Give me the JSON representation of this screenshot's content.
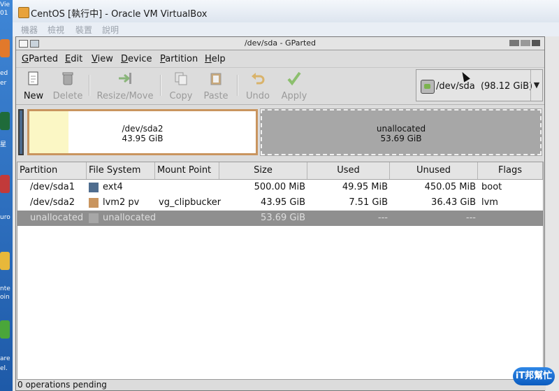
{
  "vbox": {
    "title": "CentOS [執行中] - Oracle VM VirtualBox",
    "menu": [
      "機器",
      "檢視",
      "裝置",
      "說明"
    ]
  },
  "gparted": {
    "title": "/dev/sda - GParted",
    "menu": [
      {
        "underline": "G",
        "rest": "Parted"
      },
      {
        "underline": "E",
        "rest": "dit"
      },
      {
        "underline": "V",
        "rest": "iew"
      },
      {
        "underline": "D",
        "rest": "evice"
      },
      {
        "underline": "P",
        "rest": "artition"
      },
      {
        "underline": "H",
        "rest": "elp"
      }
    ],
    "toolbar": {
      "new": "New",
      "delete": "Delete",
      "resize_move": "Resize/Move",
      "copy": "Copy",
      "paste": "Paste",
      "undo": "Undo",
      "apply": "Apply"
    },
    "device": {
      "name": "/dev/sda",
      "size": "(98.12 GiB)"
    },
    "diskmap": {
      "sda2_name": "/dev/sda2",
      "sda2_size": "43.95 GiB",
      "unallocated_name": "unallocated",
      "unallocated_size": "53.69 GiB"
    },
    "columns": [
      "Partition",
      "File System",
      "Mount Point",
      "Size",
      "Used",
      "Unused",
      "Flags"
    ],
    "rows": [
      {
        "partition": "/dev/sda1",
        "fs": "ext4",
        "fs_color": "#4f6d8f",
        "mount": "",
        "size": "500.00 MiB",
        "used": "49.95 MiB",
        "unused": "450.05 MiB",
        "flags": "boot"
      },
      {
        "partition": "/dev/sda2",
        "fs": "lvm2 pv",
        "fs_color": "#c9955f",
        "mount": "vg_clipbucker",
        "size": "43.95 GiB",
        "used": "7.51 GiB",
        "unused": "36.43 GiB",
        "flags": "lvm"
      },
      {
        "partition": "unallocated",
        "fs": "unallocated",
        "fs_color": "#a7a7a7",
        "mount": "",
        "size": "53.69 GiB",
        "used": "---",
        "unused": "---",
        "flags": ""
      }
    ],
    "status": "0 operations pending"
  },
  "desktop": {
    "labels": [
      "Vie",
      "01",
      "ed",
      "er",
      "星",
      "uro",
      "nte",
      "oin",
      "are",
      "el."
    ]
  },
  "watermark": {
    "text": "iT邦幫忙"
  }
}
